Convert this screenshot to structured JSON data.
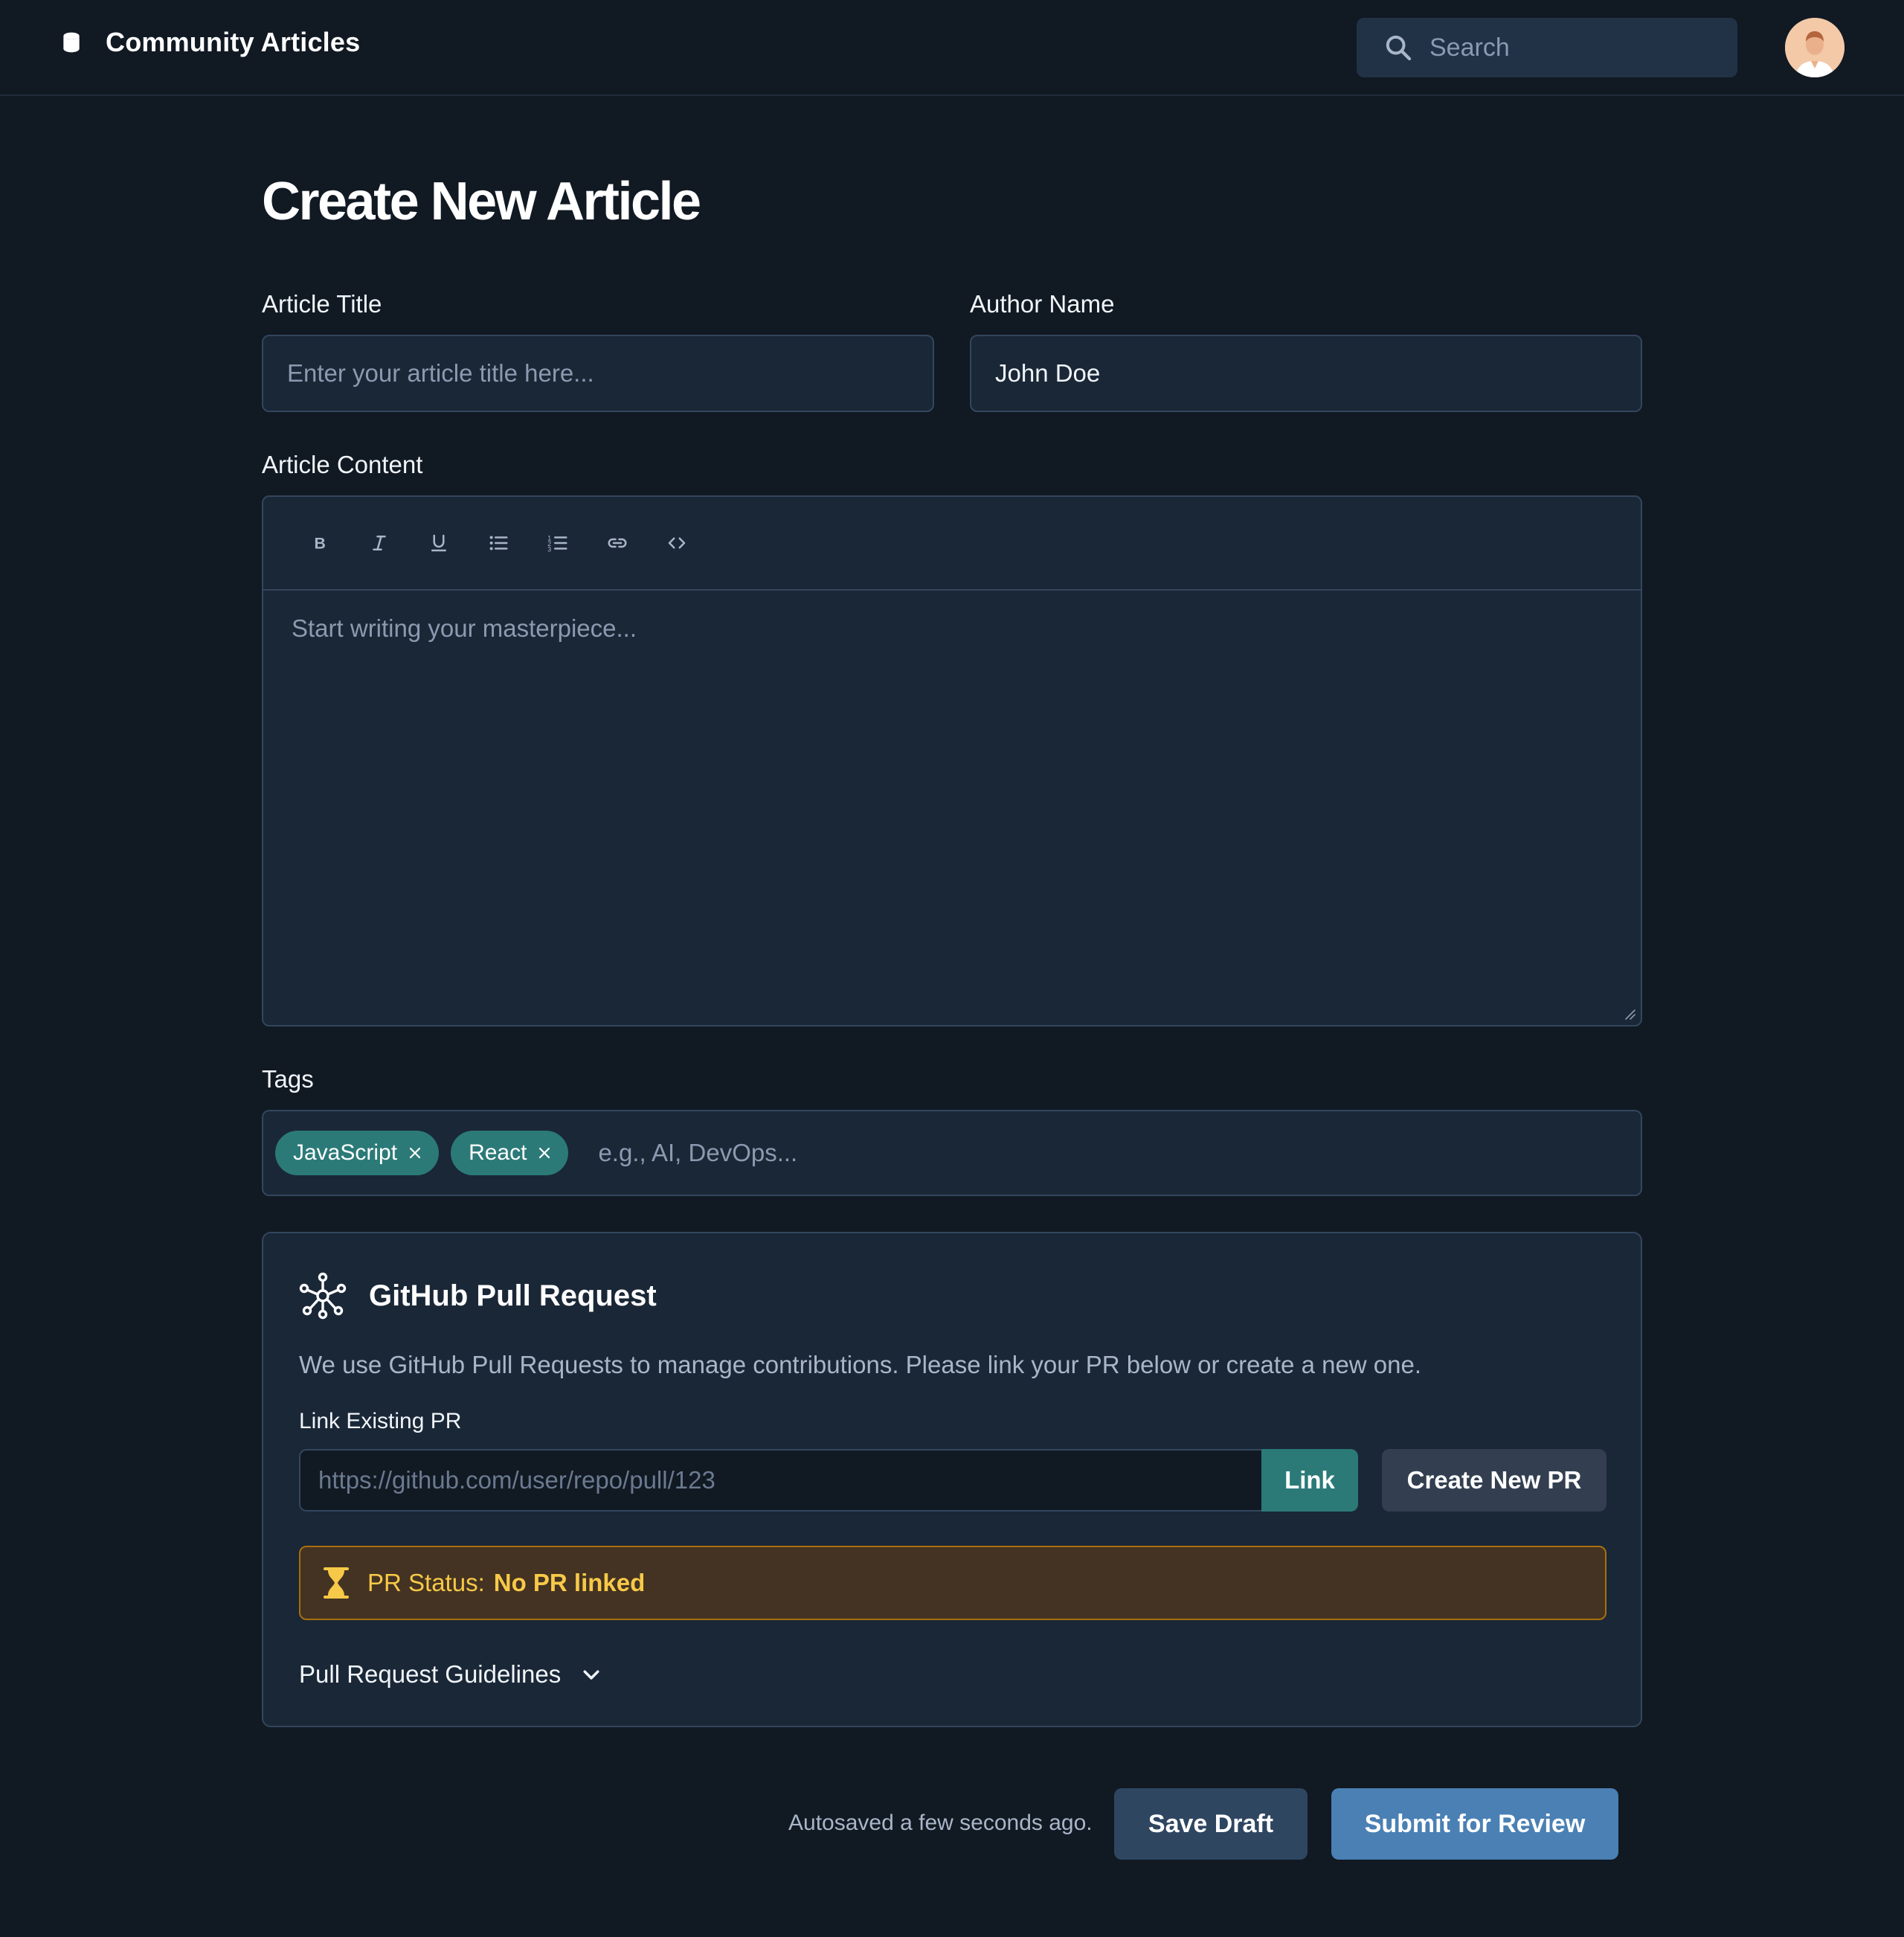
{
  "header": {
    "app_title": "Community Articles",
    "search_placeholder": "Search",
    "icons": {
      "brand": "database-icon",
      "search": "search-icon",
      "avatar": "user-avatar"
    }
  },
  "page": {
    "title": "Create New Article"
  },
  "form": {
    "title_label": "Article Title",
    "title_placeholder": "Enter your article title here...",
    "title_value": "",
    "author_label": "Author Name",
    "author_value": "John Doe",
    "content_label": "Article Content",
    "content_placeholder": "Start writing your masterpiece...",
    "toolbar": [
      "bold",
      "italic",
      "underline",
      "bulleted-list",
      "numbered-list",
      "link",
      "code"
    ],
    "tags_label": "Tags",
    "tags": [
      "JavaScript",
      "React"
    ],
    "tags_placeholder": "e.g., AI, DevOps..."
  },
  "github": {
    "title": "GitHub Pull Request",
    "description": "We use GitHub Pull Requests to manage contributions. Please link your PR below or create a new one.",
    "link_label": "Link Existing PR",
    "pr_placeholder": "https://github.com/user/repo/pull/123",
    "link_button": "Link",
    "create_button": "Create New PR",
    "status_label": "PR Status:",
    "status_value": "No PR linked",
    "guidelines_label": "Pull Request Guidelines"
  },
  "footer": {
    "autosave_text": "Autosaved a few seconds ago.",
    "save_button": "Save Draft",
    "submit_button": "Submit for Review"
  },
  "colors": {
    "background": "#111923",
    "surface": "#1a2737",
    "accent_teal": "#2b7a78",
    "primary_blue": "#4a80b4",
    "warning": "#f7c948"
  }
}
